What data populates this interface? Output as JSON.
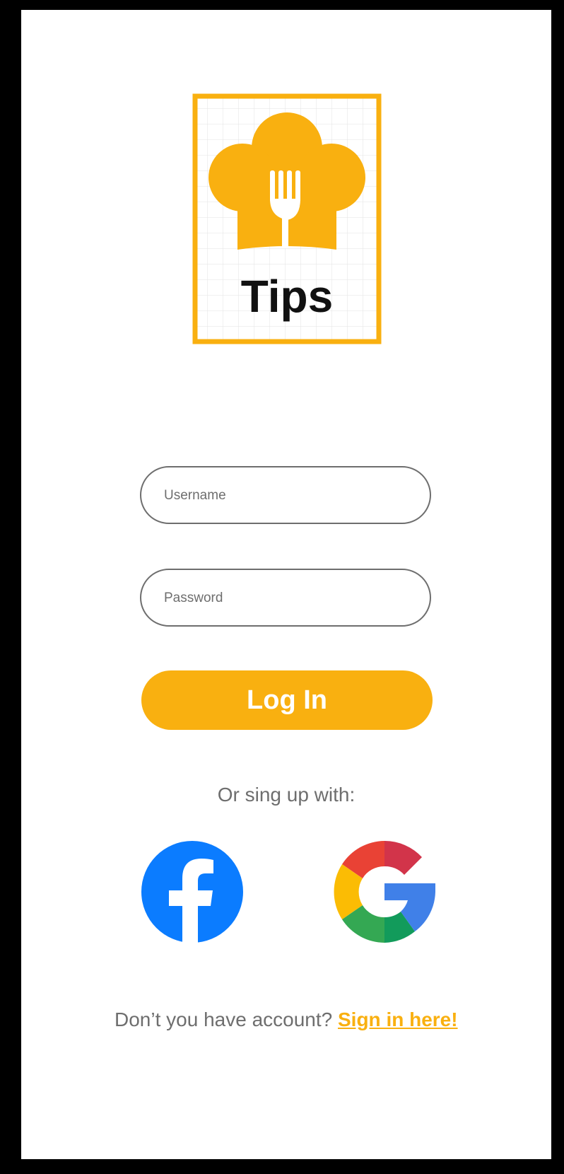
{
  "logo": {
    "text": "Tips",
    "accent_color": "#f9b010"
  },
  "form": {
    "username_placeholder": "Username",
    "password_placeholder": "Password",
    "login_label": "Log In"
  },
  "social": {
    "prompt": "Or sing up with:",
    "providers": [
      {
        "name": "facebook",
        "icon": "facebook-icon",
        "color": "#0b7cff"
      },
      {
        "name": "google",
        "icon": "google-icon"
      }
    ]
  },
  "signup": {
    "question": "Don’t you have account?",
    "link_label": "Sign in here!"
  }
}
